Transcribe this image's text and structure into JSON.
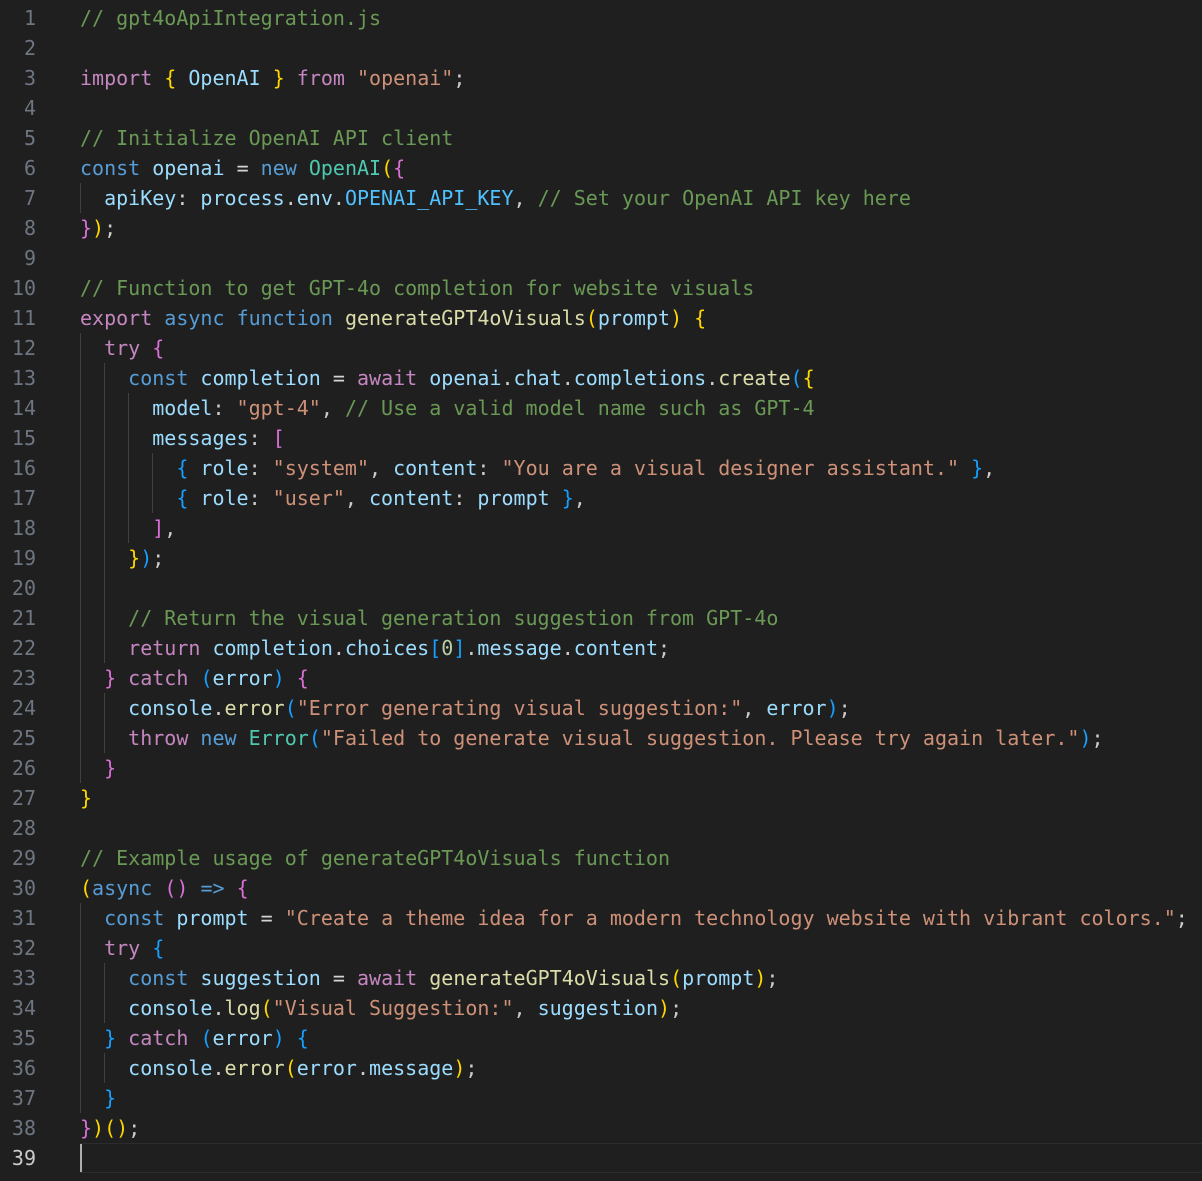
{
  "editor": {
    "file_comment": "// gpt4oApiIntegration.js",
    "active_line": 39,
    "lines": [
      {
        "n": "1",
        "indent": 0,
        "tokens": [
          [
            "// gpt4oApiIntegration.js",
            "comment"
          ]
        ]
      },
      {
        "n": "2",
        "indent": 0,
        "tokens": []
      },
      {
        "n": "3",
        "indent": 0,
        "tokens": [
          [
            "import",
            "kw"
          ],
          [
            " ",
            "punc"
          ],
          [
            "{",
            "b1"
          ],
          [
            " ",
            "punc"
          ],
          [
            "OpenAI",
            "var"
          ],
          [
            " ",
            "punc"
          ],
          [
            "}",
            "b1"
          ],
          [
            " ",
            "punc"
          ],
          [
            "from",
            "kw"
          ],
          [
            " ",
            "punc"
          ],
          [
            "\"openai\"",
            "str"
          ],
          [
            ";",
            "punc"
          ]
        ]
      },
      {
        "n": "4",
        "indent": 0,
        "tokens": []
      },
      {
        "n": "5",
        "indent": 0,
        "tokens": [
          [
            "// Initialize OpenAI API client",
            "comment"
          ]
        ]
      },
      {
        "n": "6",
        "indent": 0,
        "tokens": [
          [
            "const",
            "store"
          ],
          [
            " ",
            "punc"
          ],
          [
            "openai",
            "var"
          ],
          [
            " ",
            "punc"
          ],
          [
            "=",
            "op"
          ],
          [
            " ",
            "punc"
          ],
          [
            "new",
            "store"
          ],
          [
            " ",
            "punc"
          ],
          [
            "OpenAI",
            "cls"
          ],
          [
            "(",
            "b1"
          ],
          [
            "{",
            "b2"
          ]
        ]
      },
      {
        "n": "7",
        "indent": 1,
        "tokens": [
          [
            "apiKey",
            "var"
          ],
          [
            ": ",
            "punc"
          ],
          [
            "process",
            "var"
          ],
          [
            ".",
            "punc"
          ],
          [
            "env",
            "var"
          ],
          [
            ".",
            "punc"
          ],
          [
            "OPENAI_API_KEY",
            "const"
          ],
          [
            ", ",
            "punc"
          ],
          [
            "// Set your OpenAI API key here",
            "comment"
          ]
        ]
      },
      {
        "n": "8",
        "indent": 0,
        "tokens": [
          [
            "}",
            "b2"
          ],
          [
            ")",
            "b1"
          ],
          [
            ";",
            "punc"
          ]
        ]
      },
      {
        "n": "9",
        "indent": 0,
        "tokens": []
      },
      {
        "n": "10",
        "indent": 0,
        "tokens": [
          [
            "// Function to get GPT-4o completion for website visuals",
            "comment"
          ]
        ]
      },
      {
        "n": "11",
        "indent": 0,
        "tokens": [
          [
            "export",
            "kw"
          ],
          [
            " ",
            "punc"
          ],
          [
            "async",
            "store"
          ],
          [
            " ",
            "punc"
          ],
          [
            "function",
            "store"
          ],
          [
            " ",
            "punc"
          ],
          [
            "generateGPT4oVisuals",
            "fn"
          ],
          [
            "(",
            "b1"
          ],
          [
            "prompt",
            "var"
          ],
          [
            ")",
            "b1"
          ],
          [
            " ",
            "punc"
          ],
          [
            "{",
            "b1"
          ]
        ]
      },
      {
        "n": "12",
        "indent": 1,
        "tokens": [
          [
            "try",
            "kw"
          ],
          [
            " ",
            "punc"
          ],
          [
            "{",
            "b2"
          ]
        ]
      },
      {
        "n": "13",
        "indent": 2,
        "tokens": [
          [
            "const",
            "store"
          ],
          [
            " ",
            "punc"
          ],
          [
            "completion",
            "var"
          ],
          [
            " ",
            "punc"
          ],
          [
            "=",
            "op"
          ],
          [
            " ",
            "punc"
          ],
          [
            "await",
            "kw"
          ],
          [
            " ",
            "punc"
          ],
          [
            "openai",
            "var"
          ],
          [
            ".",
            "punc"
          ],
          [
            "chat",
            "var"
          ],
          [
            ".",
            "punc"
          ],
          [
            "completions",
            "var"
          ],
          [
            ".",
            "punc"
          ],
          [
            "create",
            "fn"
          ],
          [
            "(",
            "b3"
          ],
          [
            "{",
            "b1"
          ]
        ]
      },
      {
        "n": "14",
        "indent": 3,
        "tokens": [
          [
            "model",
            "var"
          ],
          [
            ": ",
            "punc"
          ],
          [
            "\"gpt-4\"",
            "str"
          ],
          [
            ", ",
            "punc"
          ],
          [
            "// Use a valid model name such as GPT-4",
            "comment"
          ]
        ]
      },
      {
        "n": "15",
        "indent": 3,
        "tokens": [
          [
            "messages",
            "var"
          ],
          [
            ": ",
            "punc"
          ],
          [
            "[",
            "b2"
          ]
        ]
      },
      {
        "n": "16",
        "indent": 4,
        "tokens": [
          [
            "{",
            "b3"
          ],
          [
            " ",
            "punc"
          ],
          [
            "role",
            "var"
          ],
          [
            ": ",
            "punc"
          ],
          [
            "\"system\"",
            "str"
          ],
          [
            ", ",
            "punc"
          ],
          [
            "content",
            "var"
          ],
          [
            ": ",
            "punc"
          ],
          [
            "\"You are a visual designer assistant.\"",
            "str"
          ],
          [
            " ",
            "punc"
          ],
          [
            "}",
            "b3"
          ],
          [
            ",",
            "punc"
          ]
        ]
      },
      {
        "n": "17",
        "indent": 4,
        "tokens": [
          [
            "{",
            "b3"
          ],
          [
            " ",
            "punc"
          ],
          [
            "role",
            "var"
          ],
          [
            ": ",
            "punc"
          ],
          [
            "\"user\"",
            "str"
          ],
          [
            ", ",
            "punc"
          ],
          [
            "content",
            "var"
          ],
          [
            ": ",
            "punc"
          ],
          [
            "prompt",
            "var"
          ],
          [
            " ",
            "punc"
          ],
          [
            "}",
            "b3"
          ],
          [
            ",",
            "punc"
          ]
        ]
      },
      {
        "n": "18",
        "indent": 3,
        "tokens": [
          [
            "]",
            "b2"
          ],
          [
            ",",
            "punc"
          ]
        ]
      },
      {
        "n": "19",
        "indent": 2,
        "tokens": [
          [
            "}",
            "b1"
          ],
          [
            ")",
            "b3"
          ],
          [
            ";",
            "punc"
          ]
        ]
      },
      {
        "n": "20",
        "indent": 0,
        "tokens": []
      },
      {
        "n": "21",
        "indent": 2,
        "tokens": [
          [
            "// Return the visual generation suggestion from GPT-4o",
            "comment"
          ]
        ]
      },
      {
        "n": "22",
        "indent": 2,
        "tokens": [
          [
            "return",
            "kw"
          ],
          [
            " ",
            "punc"
          ],
          [
            "completion",
            "var"
          ],
          [
            ".",
            "punc"
          ],
          [
            "choices",
            "var"
          ],
          [
            "[",
            "b3"
          ],
          [
            "0",
            "num"
          ],
          [
            "]",
            "b3"
          ],
          [
            ".",
            "punc"
          ],
          [
            "message",
            "var"
          ],
          [
            ".",
            "punc"
          ],
          [
            "content",
            "var"
          ],
          [
            ";",
            "punc"
          ]
        ]
      },
      {
        "n": "23",
        "indent": 1,
        "tokens": [
          [
            "}",
            "b2"
          ],
          [
            " ",
            "punc"
          ],
          [
            "catch",
            "kw"
          ],
          [
            " ",
            "punc"
          ],
          [
            "(",
            "b3"
          ],
          [
            "error",
            "var"
          ],
          [
            ")",
            "b3"
          ],
          [
            " ",
            "punc"
          ],
          [
            "{",
            "b2"
          ]
        ]
      },
      {
        "n": "24",
        "indent": 2,
        "tokens": [
          [
            "console",
            "var"
          ],
          [
            ".",
            "punc"
          ],
          [
            "error",
            "fn"
          ],
          [
            "(",
            "b3"
          ],
          [
            "\"Error generating visual suggestion:\"",
            "str"
          ],
          [
            ", ",
            "punc"
          ],
          [
            "error",
            "var"
          ],
          [
            ")",
            "b3"
          ],
          [
            ";",
            "punc"
          ]
        ]
      },
      {
        "n": "25",
        "indent": 2,
        "tokens": [
          [
            "throw",
            "kw"
          ],
          [
            " ",
            "punc"
          ],
          [
            "new",
            "store"
          ],
          [
            " ",
            "punc"
          ],
          [
            "Error",
            "cls"
          ],
          [
            "(",
            "b3"
          ],
          [
            "\"Failed to generate visual suggestion. Please try again later.\"",
            "str"
          ],
          [
            ")",
            "b3"
          ],
          [
            ";",
            "punc"
          ]
        ]
      },
      {
        "n": "26",
        "indent": 1,
        "tokens": [
          [
            "}",
            "b2"
          ]
        ]
      },
      {
        "n": "27",
        "indent": 0,
        "tokens": [
          [
            "}",
            "b1"
          ]
        ]
      },
      {
        "n": "28",
        "indent": 0,
        "tokens": []
      },
      {
        "n": "29",
        "indent": 0,
        "tokens": [
          [
            "// Example usage of generateGPT4oVisuals function",
            "comment"
          ]
        ]
      },
      {
        "n": "30",
        "indent": 0,
        "tokens": [
          [
            "(",
            "b1"
          ],
          [
            "async",
            "store"
          ],
          [
            " ",
            "punc"
          ],
          [
            "(",
            "b2"
          ],
          [
            ")",
            "b2"
          ],
          [
            " ",
            "punc"
          ],
          [
            "=>",
            "store"
          ],
          [
            " ",
            "punc"
          ],
          [
            "{",
            "b2"
          ]
        ]
      },
      {
        "n": "31",
        "indent": 1,
        "tokens": [
          [
            "const",
            "store"
          ],
          [
            " ",
            "punc"
          ],
          [
            "prompt",
            "var"
          ],
          [
            " ",
            "punc"
          ],
          [
            "=",
            "op"
          ],
          [
            " ",
            "punc"
          ],
          [
            "\"Create a theme idea for a modern technology website with vibrant colors.\"",
            "str"
          ],
          [
            ";",
            "punc"
          ]
        ]
      },
      {
        "n": "32",
        "indent": 1,
        "tokens": [
          [
            "try",
            "kw"
          ],
          [
            " ",
            "punc"
          ],
          [
            "{",
            "b3"
          ]
        ]
      },
      {
        "n": "33",
        "indent": 2,
        "tokens": [
          [
            "const",
            "store"
          ],
          [
            " ",
            "punc"
          ],
          [
            "suggestion",
            "var"
          ],
          [
            " ",
            "punc"
          ],
          [
            "=",
            "op"
          ],
          [
            " ",
            "punc"
          ],
          [
            "await",
            "kw"
          ],
          [
            " ",
            "punc"
          ],
          [
            "generateGPT4oVisuals",
            "fn"
          ],
          [
            "(",
            "b1"
          ],
          [
            "prompt",
            "var"
          ],
          [
            ")",
            "b1"
          ],
          [
            ";",
            "punc"
          ]
        ]
      },
      {
        "n": "34",
        "indent": 2,
        "tokens": [
          [
            "console",
            "var"
          ],
          [
            ".",
            "punc"
          ],
          [
            "log",
            "fn"
          ],
          [
            "(",
            "b1"
          ],
          [
            "\"Visual Suggestion:\"",
            "str"
          ],
          [
            ", ",
            "punc"
          ],
          [
            "suggestion",
            "var"
          ],
          [
            ")",
            "b1"
          ],
          [
            ";",
            "punc"
          ]
        ]
      },
      {
        "n": "35",
        "indent": 1,
        "tokens": [
          [
            "}",
            "b3"
          ],
          [
            " ",
            "punc"
          ],
          [
            "catch",
            "kw"
          ],
          [
            " ",
            "punc"
          ],
          [
            "(",
            "b3"
          ],
          [
            "error",
            "var"
          ],
          [
            ")",
            "b3"
          ],
          [
            " ",
            "punc"
          ],
          [
            "{",
            "b3"
          ]
        ]
      },
      {
        "n": "36",
        "indent": 2,
        "tokens": [
          [
            "console",
            "var"
          ],
          [
            ".",
            "punc"
          ],
          [
            "error",
            "fn"
          ],
          [
            "(",
            "b1"
          ],
          [
            "error",
            "var"
          ],
          [
            ".",
            "punc"
          ],
          [
            "message",
            "var"
          ],
          [
            ")",
            "b1"
          ],
          [
            ";",
            "punc"
          ]
        ]
      },
      {
        "n": "37",
        "indent": 1,
        "tokens": [
          [
            "}",
            "b3"
          ]
        ]
      },
      {
        "n": "38",
        "indent": 0,
        "tokens": [
          [
            "}",
            "b2"
          ],
          [
            ")",
            "b1"
          ],
          [
            "(",
            "b1"
          ],
          [
            ")",
            "b1"
          ],
          [
            ";",
            "punc"
          ]
        ]
      },
      {
        "n": "39",
        "indent": 0,
        "tokens": []
      }
    ]
  },
  "colors": {
    "background": "#1f1f1f",
    "line_number": "#6e7681",
    "comment": "#6a9955",
    "keyword": "#c586c0",
    "storage": "#569cd6",
    "variable": "#9cdcfe",
    "string": "#ce9178",
    "function": "#dcdcaa",
    "class": "#4ec9b0"
  }
}
